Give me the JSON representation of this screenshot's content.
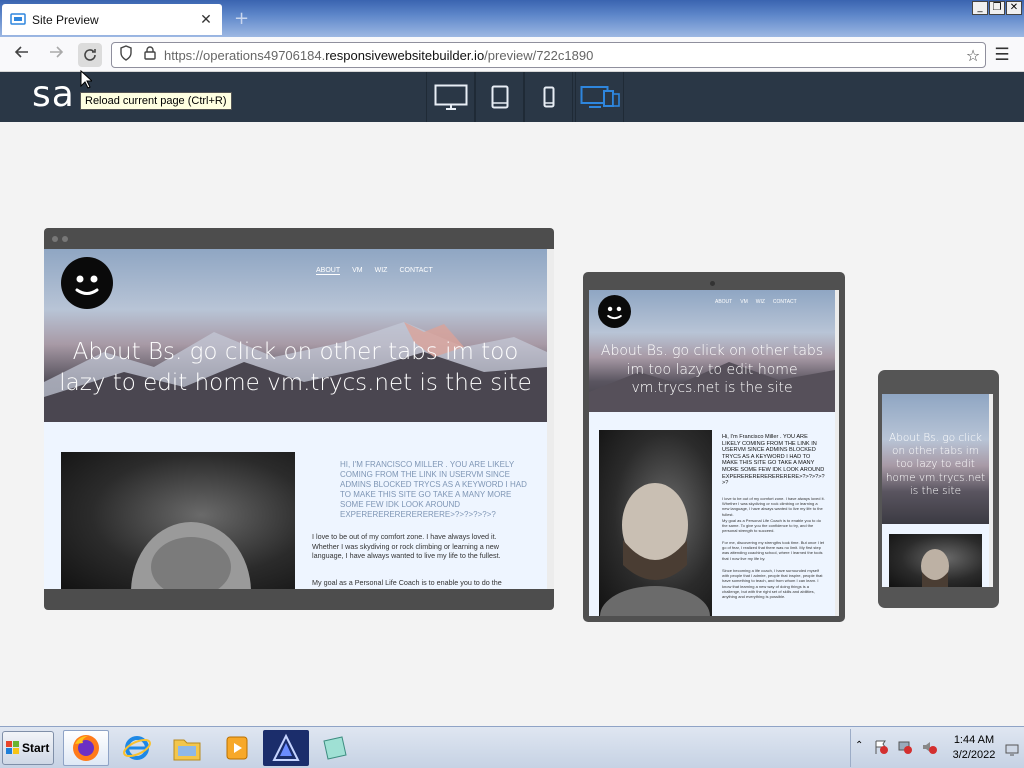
{
  "browser": {
    "tab_title": "Site Preview",
    "url_prefix": "https://operations49706184.",
    "url_domain": "responsivewebsitebuilder.io",
    "url_path": "/preview/722c1890",
    "tooltip": "Reload current page (Ctrl+R)"
  },
  "preview": {
    "logo_text": "sa",
    "devices": [
      "desktop-icon",
      "tablet-icon",
      "phone-icon",
      "all-devices-icon"
    ]
  },
  "site": {
    "nav": [
      "About",
      "VM",
      "Wiz",
      "Contact"
    ],
    "hero_title": "About Bs. go click on other tabs im too lazy to edit home vm.trycs.net is the site",
    "intro": "Hi, I'm Francisco Miller . YOU ARE LIKELY COMING FROM THE LINK IN USERVM SINCE ADMINS BLOCKED TRYCS AS A KEYWORD I HAD TO MAKE THIS SITE GO TAKE A MANY MORE SOME FEW IDK LOOK AROUND EXPERERERERERERERERE>?>?>?>?>?",
    "para1": "I love to be out of my comfort zone. I have always loved it. Whether I was skydiving or rock climbing or learning a new language, I have always wanted to live my life to the fullest.",
    "para2": "My goal as a Personal Life Coach is to enable you to do the same. To give you the confidence to try, and the personal strength to succeed.",
    "para3": "For me, discovering my strengths took time. But once I let go of fear, I realized that there was no limit. My first step was attending coaching school, where I learned the tools that I now live my life by.",
    "para4": "Since becoming a life coach, I have surrounded myself with people that I admire, people that inspire, people that have something to teach, and from whom I can learn. I know that learning a new way of doing things is a challenge, but with the right set of skills and abilities, anything and everything is possible."
  },
  "taskbar": {
    "start_label": "Start",
    "time": "1:44 AM",
    "date": "3/2/2022"
  },
  "colors": {
    "preview_header": "#2a3746",
    "accent_blue": "#2e86de"
  }
}
